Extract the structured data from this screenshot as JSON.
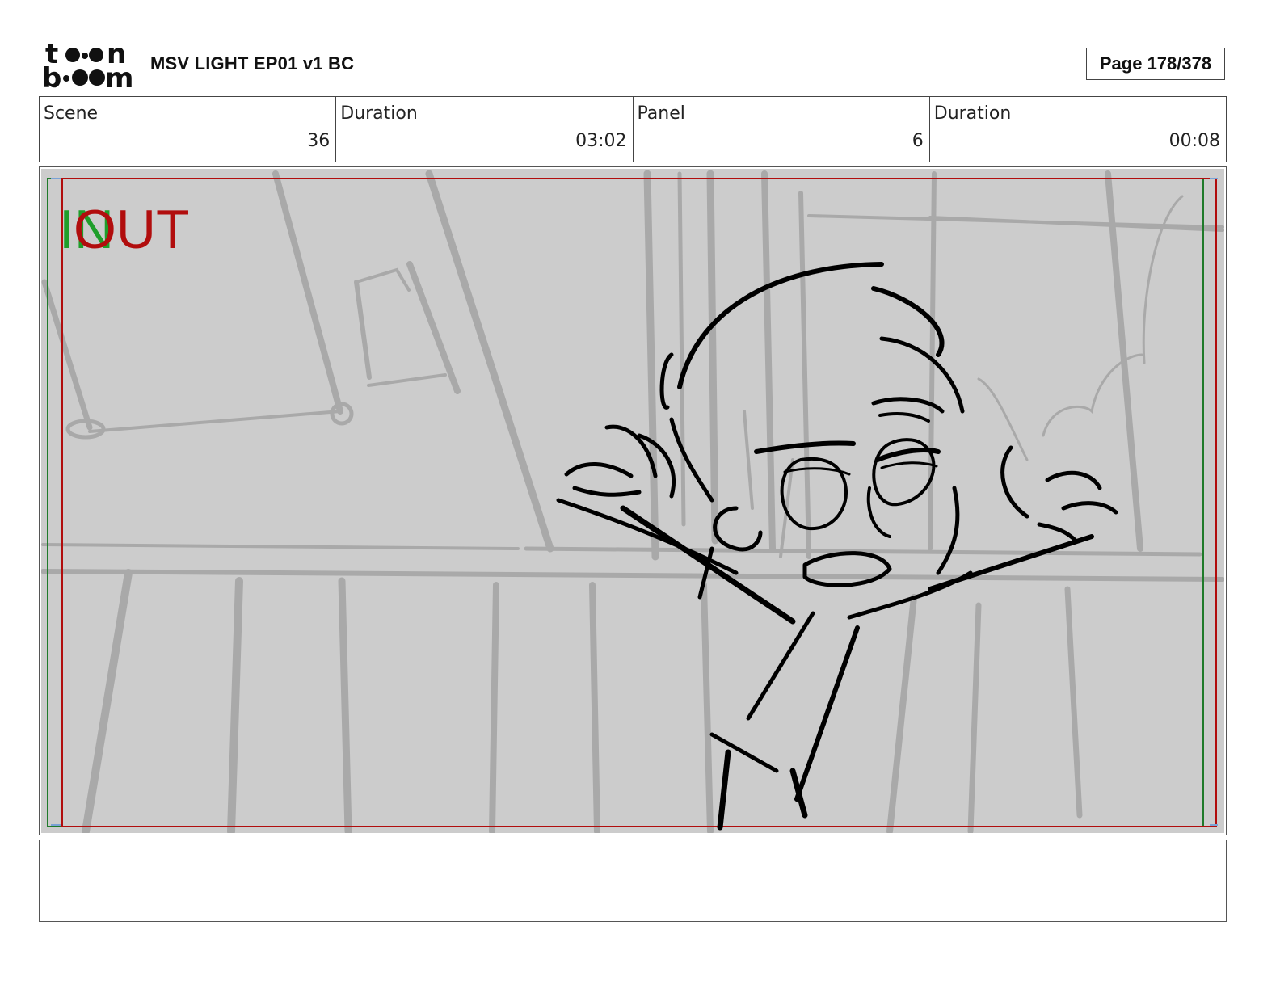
{
  "header": {
    "logo_text": "toon boom",
    "title": "MSV LIGHT EP01 v1 BC",
    "page": "Page 178/378"
  },
  "info": [
    {
      "label": "Scene",
      "value": "36"
    },
    {
      "label": "Duration",
      "value": "03:02"
    },
    {
      "label": "Panel",
      "value": "6"
    },
    {
      "label": "Duration",
      "value": "00:08"
    }
  ],
  "panel": {
    "in_label": "IN",
    "out_label": "OUT",
    "in_color": "#1f9e2a",
    "out_color": "#b10d0d",
    "background_color": "#cccccc"
  },
  "notes": ""
}
